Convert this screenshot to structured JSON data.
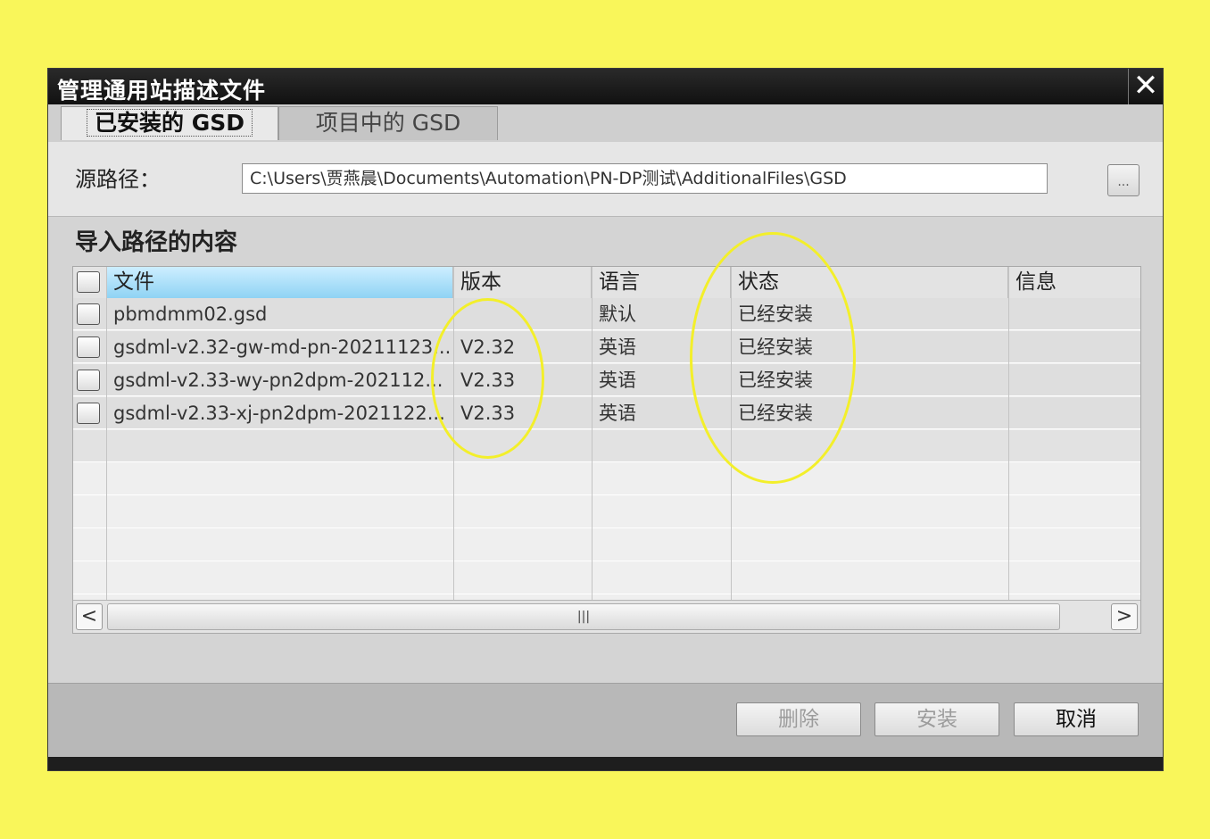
{
  "dialog": {
    "title": "管理通用站描述文件",
    "close_glyph": "✕",
    "tabs": [
      {
        "label": "已安装的 GSD",
        "active": true
      },
      {
        "label": "项目中的 GSD",
        "active": false
      }
    ],
    "source_path": {
      "label": "源路径：",
      "value": "C:\\Users\\贾燕晨\\Documents\\Automation\\PN-DP测试\\AdditionalFiles\\GSD",
      "browse_label": "..."
    },
    "section_title": "导入路径的内容",
    "table": {
      "columns": [
        "文件",
        "版本",
        "语言",
        "状态",
        "信息"
      ],
      "rows": [
        {
          "file": "pbmdmm02.gsd",
          "version": "",
          "language": "默认",
          "status": "已经安装",
          "info": ""
        },
        {
          "file": "gsdml-v2.32-gw-md-pn-20211123...",
          "version": "V2.32",
          "language": "英语",
          "status": "已经安装",
          "info": ""
        },
        {
          "file": "gsdml-v2.33-wy-pn2dpm-202112...",
          "version": "V2.33",
          "language": "英语",
          "status": "已经安装",
          "info": ""
        },
        {
          "file": "gsdml-v2.33-xj-pn2dpm-2021122...",
          "version": "V2.33",
          "language": "英语",
          "status": "已经安装",
          "info": ""
        }
      ],
      "scroll_left": "<",
      "scroll_right": ">",
      "scroll_thumb": "|||"
    },
    "buttons": {
      "delete": "删除",
      "install": "安装",
      "cancel": "取消"
    },
    "colors": {
      "background": "#f9f65a",
      "highlight": "#f3ef2a",
      "header_selected": "#8fd3f4"
    }
  }
}
